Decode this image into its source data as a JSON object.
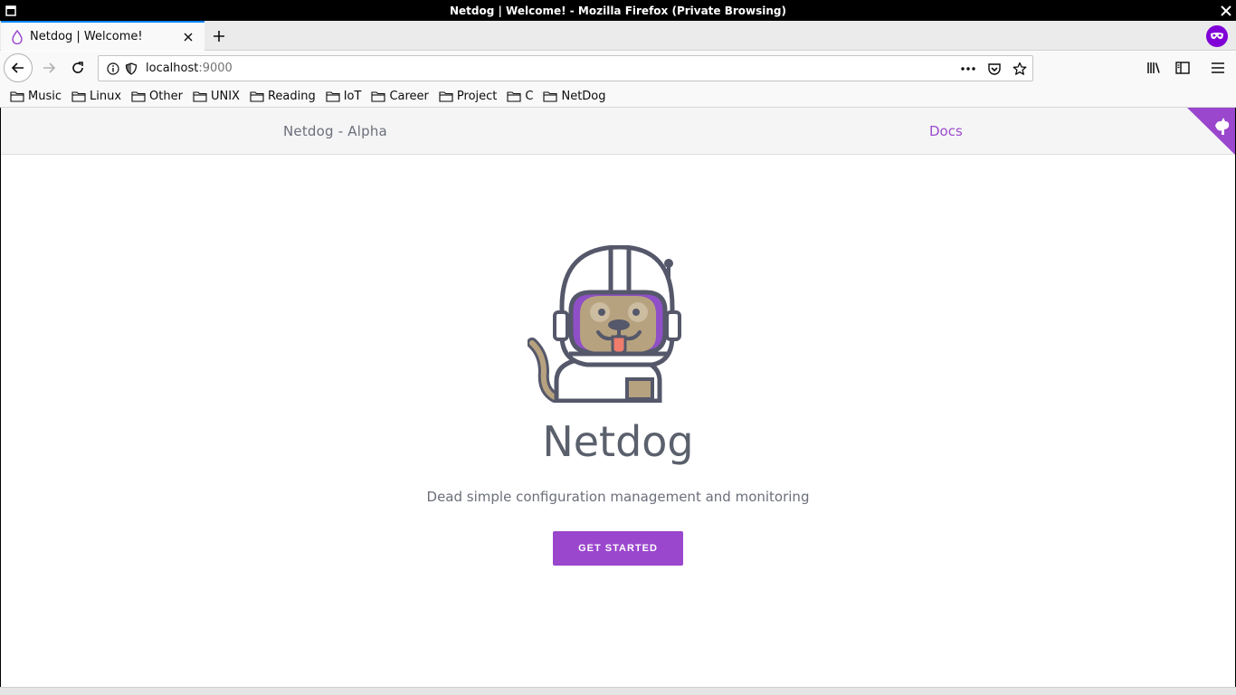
{
  "window": {
    "title": "Netdog  |  Welcome! - Mozilla Firefox (Private Browsing)"
  },
  "tab": {
    "title": "Netdog | Welcome!"
  },
  "address_bar": {
    "host": "localhost",
    "port": ":9000"
  },
  "bookmarks": [
    {
      "label": "Music"
    },
    {
      "label": "Linux"
    },
    {
      "label": "Other"
    },
    {
      "label": "UNIX"
    },
    {
      "label": "Reading"
    },
    {
      "label": "IoT"
    },
    {
      "label": "Career"
    },
    {
      "label": "Project"
    },
    {
      "label": "C"
    },
    {
      "label": "NetDog"
    }
  ],
  "page": {
    "brand": "Netdog - Alpha",
    "docs_link": "Docs",
    "hero_title": "Netdog",
    "hero_subtitle": "Dead simple configuration management and monitoring",
    "cta_label": "GET STARTED"
  },
  "colors": {
    "accent": "#9a46cd",
    "link": "#9c4ccc",
    "private_browsing": "#8000d7",
    "text_muted": "#6b6f7a"
  }
}
